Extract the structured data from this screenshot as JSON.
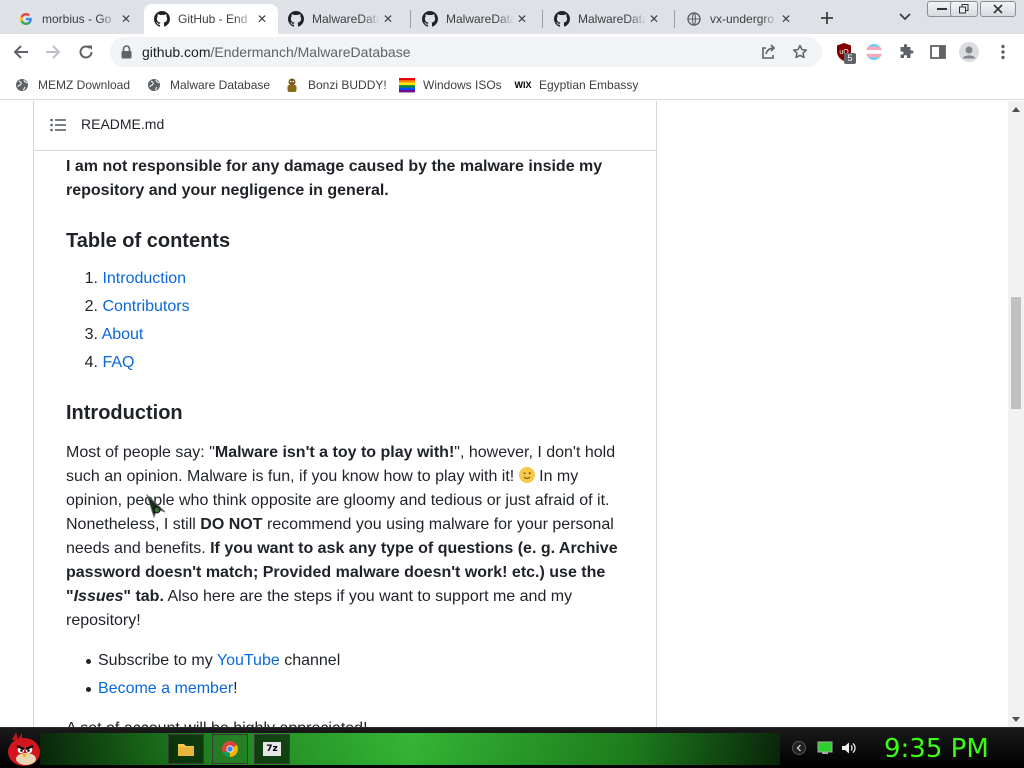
{
  "browser": {
    "tabs": [
      {
        "title": "morbius - Go",
        "favicon": "google-icon",
        "active": false
      },
      {
        "title": "GitHub - End",
        "favicon": "github-icon",
        "active": true
      },
      {
        "title": "MalwareData",
        "favicon": "github-icon",
        "active": false
      },
      {
        "title": "MalwareData",
        "favicon": "github-icon",
        "active": false
      },
      {
        "title": "MalwareData",
        "favicon": "github-icon",
        "active": false
      },
      {
        "title": "vx-undergro",
        "favicon": "globe-icon",
        "active": false
      }
    ],
    "url": {
      "host": "github.com",
      "path": "/Endermanch/MalwareDatabase"
    },
    "extension_badge": "5",
    "bookmarks": [
      {
        "label": "MEMZ Download",
        "icon": "globe-icon"
      },
      {
        "label": "Malware Database",
        "icon": "globe-icon"
      },
      {
        "label": "Bonzi BUDDY!",
        "icon": "bonzi-icon"
      },
      {
        "label": "Windows ISOs",
        "icon": "windows-flag-icon"
      },
      {
        "label": "Egyptian Embassy",
        "icon": "wix-icon"
      }
    ]
  },
  "readme": {
    "filename": "README.md",
    "disclaimer": "I am not responsible for any damage caused by the malware inside my repository and your negligence in general.",
    "toc_heading": "Table of contents",
    "toc": [
      {
        "num": "1.",
        "label": "Introduction"
      },
      {
        "num": "2.",
        "label": "Contributors"
      },
      {
        "num": "3.",
        "label": "About"
      },
      {
        "num": "4.",
        "label": "FAQ"
      }
    ],
    "intro_heading": "Introduction",
    "intro": {
      "l1a": "Most of people say: \"",
      "l1b": "Malware isn't a toy to play with!",
      "l1c": "\", however, I don't hold",
      "l2": "such an opinion. Malware is fun, if you know how to play with it!",
      "l2b": "In my",
      "l3": "opinion, people who think opposite are gloomy and tedious or just afraid of it.",
      "l4a": "Nonetheless, I still ",
      "l4b": "DO NOT",
      "l4c": " recommend you using malware for your personal",
      "l5a": "needs and benefits. ",
      "l5b": "If you want to ask any type of questions (e. g. Archive",
      "l6": "password doesn't match; Provided malware doesn't work! etc.) use the",
      "l7a": "\"",
      "l7b": "Issues",
      "l7c": "\" tab.",
      "l7d": " Also here are the steps if you want to support me and my",
      "l8": "repository!"
    },
    "support_items": [
      {
        "pre": "Subscribe to my ",
        "link": "YouTube",
        "post": " channel"
      },
      {
        "pre": "",
        "link": "Become a member",
        "post": "!"
      }
    ],
    "cutoff_line": "A set of account will be highly appreciated!"
  },
  "taskbar": {
    "clock": "9:35 PM",
    "apps": [
      "file-explorer-icon",
      "chrome-icon",
      "7zip-icon"
    ],
    "app_7zip_label": "7z"
  }
}
